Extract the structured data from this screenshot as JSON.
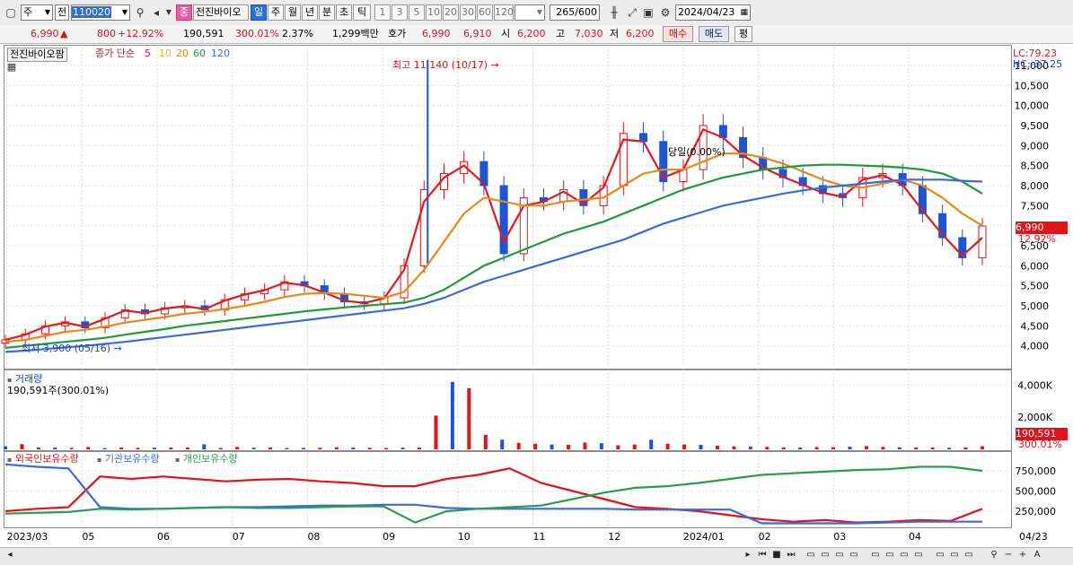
{
  "toolbar": {
    "interval": "주",
    "market": "전",
    "code": "110020",
    "stock_name": "전진바이오",
    "stock_badge": "종",
    "periods": [
      "일",
      "주",
      "월",
      "년",
      "분",
      "초",
      "틱"
    ],
    "active_period": "일",
    "ticks": [
      "1",
      "3",
      "5",
      "10",
      "20",
      "30",
      "60",
      "120"
    ],
    "count_current": "265",
    "count_total": "/600",
    "date": "2024/04/23"
  },
  "quote": {
    "price": "6,990",
    "arrow": "▲",
    "change": "800",
    "change_pct": "+12.92%",
    "volume": "190,591",
    "volume_pct": "300.01%",
    "turnover": "2.37%",
    "amount": "1,299백만",
    "ask_label": "호가",
    "ask1": "6,990",
    "ask2": "6,910",
    "open_label": "시",
    "open": "6,200",
    "high_label": "고",
    "high": "7,030",
    "low_label": "저",
    "low": "6,200",
    "buy": "매수",
    "sell": "매도",
    "eval": "평"
  },
  "price_panel": {
    "title": "전진바이오팜",
    "legend_prefix": "종가 단순",
    "ma_labels": [
      "5",
      "10",
      "20",
      "60",
      "120"
    ],
    "ma_colors": [
      "#e8191e",
      "#f2b21b",
      "#e68a1a",
      "#1e9b3c",
      "#3b6ae0"
    ],
    "lc": "LC:79.23",
    "hc": "HC:-37.25",
    "high_annot": "최고 11,140 (10/17) →",
    "low_annot": "최저 3,900 (05/16) →",
    "mid_annot": "당일(0.00%)",
    "last_price_tag": "6,990",
    "last_pct_tag": "12.92%"
  },
  "volume_panel": {
    "title": "거래량",
    "subtitle": "190,591주(300.01%)",
    "last_tag": "190,591",
    "last_pct": "300.01%"
  },
  "holding_panel": {
    "labels": [
      "외국인보유수량",
      "기관보유수량",
      "개인보유수량"
    ],
    "colors": [
      "#e3131a",
      "#3b6ae0",
      "#2b9b50"
    ]
  },
  "x_axis": {
    "labels": [
      "2023/03",
      "05",
      "06",
      "07",
      "08",
      "09",
      "10",
      "11",
      "12",
      "2024/01",
      "02",
      "03",
      "04"
    ],
    "right_label": "04/23"
  },
  "chart_data": [
    {
      "type": "candlestick",
      "title": "전진바이오팜",
      "x_labels": [
        "2023/03",
        "05",
        "06",
        "07",
        "08",
        "09",
        "10",
        "11",
        "12",
        "2024/01",
        "02",
        "03",
        "04",
        "04/23"
      ],
      "ylim": [
        3500,
        11200
      ],
      "y_ticks": [
        4000,
        4500,
        5000,
        5500,
        6000,
        6500,
        7000,
        7500,
        8000,
        8500,
        9000,
        9500,
        10000,
        10500,
        11000
      ],
      "y_tick_labels": [
        "4,000",
        "4,500",
        "5,000",
        "5,500",
        "6,000",
        "6,500",
        "7,000",
        "7,500",
        "8,000",
        "8,500",
        "9,000",
        "9,500",
        "10,000",
        "10,500",
        "11,000"
      ],
      "close_trend": [
        4150,
        4300,
        4500,
        4600,
        4450,
        4700,
        4900,
        4800,
        4950,
        5000,
        4900,
        5150,
        5300,
        5400,
        5600,
        5500,
        5300,
        5100,
        5050,
        5200,
        6000,
        7900,
        8300,
        8600,
        8000,
        6300,
        7700,
        7600,
        7900,
        7500,
        8000,
        9300,
        9100,
        8100,
        8400,
        9500,
        9200,
        8700,
        8400,
        8200,
        8000,
        7800,
        7700,
        8200,
        8300,
        8000,
        7300,
        6700,
        6200,
        6990
      ],
      "ma_series": [
        {
          "name": "5",
          "values": [
            4150,
            4280,
            4480,
            4580,
            4480,
            4680,
            4880,
            4820,
            4930,
            4990,
            4920,
            5130,
            5280,
            5390,
            5580,
            5510,
            5330,
            5130,
            5070,
            5190,
            5900,
            7600,
            8200,
            8500,
            8050,
            6600,
            7500,
            7600,
            7850,
            7550,
            7950,
            9150,
            9100,
            8200,
            8400,
            9400,
            9200,
            8750,
            8450,
            8220,
            8020,
            7820,
            7720,
            8150,
            8260,
            8020,
            7380,
            6780,
            6250,
            6700
          ]
        },
        {
          "name": "20",
          "values": [
            4100,
            4150,
            4250,
            4350,
            4400,
            4480,
            4580,
            4650,
            4720,
            4800,
            4850,
            4920,
            5000,
            5100,
            5220,
            5300,
            5320,
            5300,
            5250,
            5200,
            5350,
            5900,
            6600,
            7300,
            7700,
            7600,
            7500,
            7500,
            7600,
            7650,
            7700,
            8000,
            8300,
            8400,
            8400,
            8600,
            8800,
            8800,
            8700,
            8550,
            8350,
            8150,
            8000,
            7950,
            8050,
            8150,
            8000,
            7700,
            7300,
            7000
          ]
        },
        {
          "name": "60",
          "values": [
            3950,
            4000,
            4050,
            4100,
            4150,
            4200,
            4280,
            4350,
            4420,
            4500,
            4560,
            4620,
            4680,
            4740,
            4800,
            4860,
            4910,
            4960,
            5000,
            5040,
            5080,
            5200,
            5400,
            5700,
            6000,
            6200,
            6400,
            6600,
            6800,
            6950,
            7100,
            7300,
            7500,
            7700,
            7900,
            8050,
            8200,
            8300,
            8400,
            8450,
            8500,
            8520,
            8520,
            8500,
            8480,
            8450,
            8400,
            8300,
            8100,
            7800
          ]
        },
        {
          "name": "120",
          "values": [
            3850,
            3880,
            3920,
            3960,
            4000,
            4050,
            4100,
            4160,
            4220,
            4280,
            4340,
            4400,
            4460,
            4520,
            4580,
            4640,
            4700,
            4760,
            4820,
            4880,
            4940,
            5050,
            5200,
            5400,
            5600,
            5750,
            5900,
            6050,
            6200,
            6350,
            6500,
            6650,
            6850,
            7050,
            7200,
            7350,
            7500,
            7600,
            7700,
            7800,
            7880,
            7950,
            8000,
            8050,
            8100,
            8150,
            8150,
            8150,
            8120,
            8100
          ]
        }
      ],
      "annotations": {
        "high": 11140,
        "high_date": "10/17",
        "low": 3900,
        "low_date": "05/16"
      }
    },
    {
      "type": "bar",
      "title": "거래량",
      "ylim": [
        0,
        4300000
      ],
      "y_ticks": [
        2000000,
        4000000
      ],
      "y_tick_labels": [
        "2,000K",
        "4,000K"
      ],
      "values": [
        180,
        320,
        120,
        110,
        90,
        140,
        80,
        120,
        90,
        100,
        110,
        120,
        310,
        90,
        150,
        100,
        120,
        80,
        90,
        100,
        130,
        110,
        95,
        85,
        100,
        105,
        2100,
        4200,
        3800,
        900,
        600,
        400,
        350,
        300,
        280,
        420,
        380,
        250,
        300,
        600,
        350,
        300,
        280,
        220,
        180,
        170,
        150,
        120,
        110,
        140,
        130,
        160,
        200,
        150,
        130,
        120,
        110,
        100,
        120,
        190
      ],
      "unit": "thousand shares"
    },
    {
      "type": "line",
      "title": "보유수량",
      "ylim": [
        50000,
        850000
      ],
      "y_ticks": [
        250000,
        500000,
        750000
      ],
      "y_tick_labels": [
        "250,000",
        "500,000",
        "750,000"
      ],
      "series": [
        {
          "name": "외국인보유수량",
          "values": [
            250000,
            280000,
            300000,
            680000,
            650000,
            680000,
            650000,
            620000,
            640000,
            650000,
            620000,
            600000,
            560000,
            560000,
            650000,
            700000,
            780000,
            600000,
            500000,
            400000,
            300000,
            280000,
            250000,
            200000,
            150000,
            120000,
            140000,
            110000,
            120000,
            140000,
            130000,
            280000
          ]
        },
        {
          "name": "기관보유수량",
          "values": [
            830000,
            800000,
            780000,
            300000,
            280000,
            280000,
            290000,
            300000,
            300000,
            310000,
            320000,
            320000,
            330000,
            330000,
            290000,
            280000,
            280000,
            280000,
            280000,
            280000,
            270000,
            270000,
            270000,
            270000,
            100000,
            100000,
            100000,
            100000,
            110000,
            120000,
            120000,
            120000
          ]
        },
        {
          "name": "개인보유수량",
          "values": [
            220000,
            230000,
            240000,
            280000,
            270000,
            280000,
            290000,
            300000,
            290000,
            290000,
            300000,
            310000,
            310000,
            110000,
            250000,
            280000,
            300000,
            320000,
            400000,
            480000,
            540000,
            560000,
            600000,
            650000,
            700000,
            720000,
            740000,
            760000,
            770000,
            800000,
            800000,
            750000
          ]
        }
      ]
    }
  ]
}
